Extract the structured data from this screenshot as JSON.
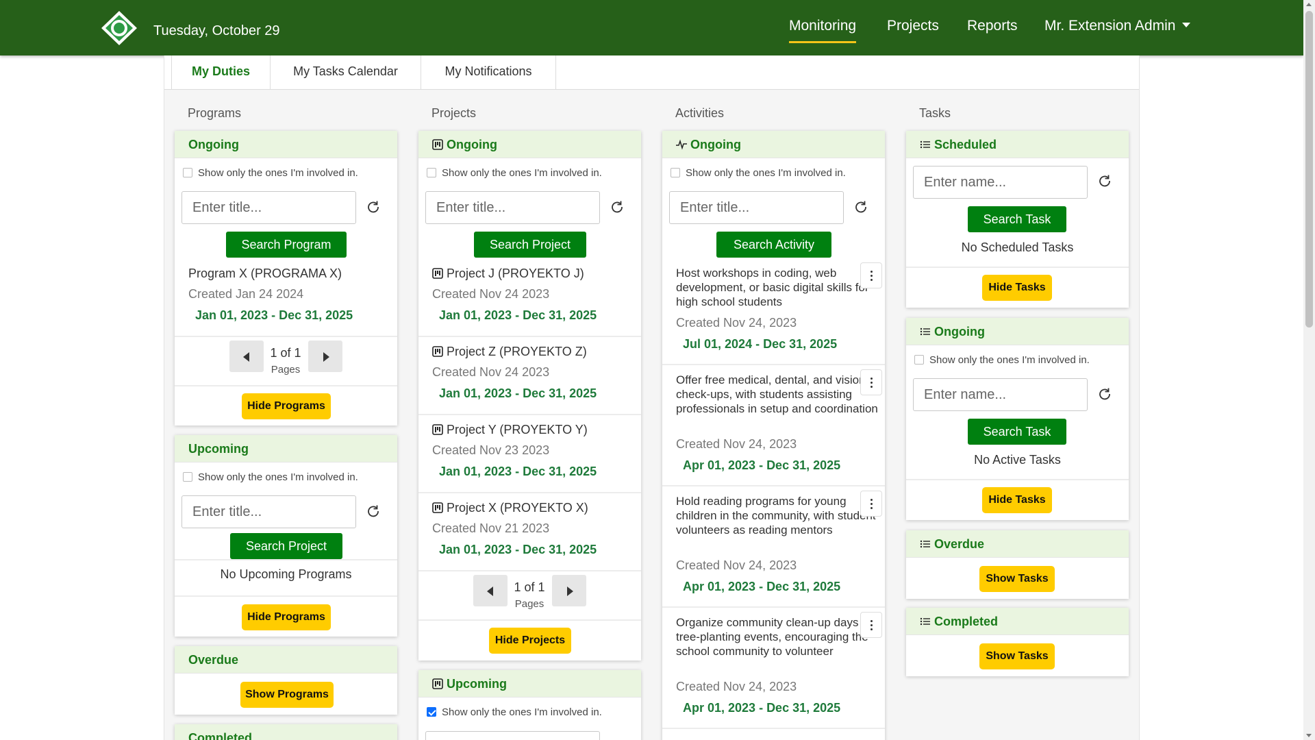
{
  "header": {
    "date": "Tuesday, October 29",
    "nav": {
      "monitoring": "Monitoring",
      "projects": "Projects",
      "reports": "Reports",
      "user": "Mr. Extension Admin"
    }
  },
  "tabs": {
    "duties": "My Duties",
    "calendar": "My Tasks Calendar",
    "notifications": "My Notifications"
  },
  "columns": {
    "programs": "Programs",
    "projects": "Projects",
    "activities": "Activities",
    "tasks": "Tasks"
  },
  "common": {
    "show_only": "Show only the ones I'm involved in."
  },
  "programs": {
    "ongoing": {
      "header": "Ongoing",
      "placeholder": "Enter title...",
      "search": "Search Program",
      "items": [
        {
          "title": "Program X (PROGRAMA X)",
          "created": "Created Jan 24 2024",
          "range": "Jan 01, 2023 - Dec 31, 2025"
        }
      ],
      "pager": {
        "count": "1 of 1",
        "label": "Pages"
      },
      "hide": "Hide Programs"
    },
    "upcoming": {
      "header": "Upcoming",
      "placeholder": "Enter title...",
      "search": "Search Project",
      "empty": "No Upcoming Programs",
      "hide": "Hide Programs"
    },
    "overdue": {
      "header": "Overdue",
      "show": "Show Programs"
    },
    "completed": {
      "header": "Completed"
    }
  },
  "projects": {
    "ongoing": {
      "header": "Ongoing",
      "placeholder": "Enter title...",
      "search": "Search Project",
      "items": [
        {
          "title": "Project J (PROYEKTO J)",
          "created": "Created Nov 24 2023",
          "range": "Jan 01, 2023 - Dec 31, 2025"
        },
        {
          "title": "Project Z (PROYEKTO Z)",
          "created": "Created Nov 24 2023",
          "range": "Jan 01, 2023 - Dec 31, 2025"
        },
        {
          "title": "Project Y (PROYEKTO Y)",
          "created": "Created Nov 23 2023",
          "range": "Jan 01, 2023 - Dec 31, 2025"
        },
        {
          "title": "Project X (PROYEKTO X)",
          "created": "Created Nov 21 2023",
          "range": "Jan 01, 2023 - Dec 31, 2025"
        }
      ],
      "pager": {
        "count": "1 of 1",
        "label": "Pages"
      },
      "hide": "Hide Projects"
    },
    "upcoming": {
      "header": "Upcoming",
      "show_only_checked": true
    }
  },
  "activities": {
    "ongoing": {
      "header": "Ongoing",
      "placeholder": "Enter title...",
      "search": "Search Activity",
      "items": [
        {
          "title": "Host workshops in coding, web development, or basic digital skills for high school students",
          "created": "Created Nov 24, 2023",
          "range": "Jul 01, 2024 - Dec 31, 2025"
        },
        {
          "title": "Offer free medical, dental, and vision check-ups, with students assisting professionals in setup and coordination",
          "created": "Created Nov 24, 2023",
          "range": "Apr 01, 2023 - Dec 31, 2025"
        },
        {
          "title": "Hold reading programs for young children in the community, with student volunteers as reading mentors",
          "created": "Created Nov 24, 2023",
          "range": "Apr 01, 2023 - Dec 31, 2025"
        },
        {
          "title": "Organize community clean-up days or tree-planting events, encouraging the school community to volunteer",
          "created": "Created Nov 24, 2023",
          "range": "Apr 01, 2023 - Dec 31, 2025"
        }
      ]
    }
  },
  "tasks": {
    "scheduled": {
      "header": "Scheduled",
      "placeholder": "Enter name...",
      "search": "Search Task",
      "empty": "No Scheduled Tasks",
      "hide": "Hide Tasks"
    },
    "ongoing": {
      "header": "Ongoing",
      "placeholder": "Enter name...",
      "search": "Search Task",
      "empty": "No Active Tasks",
      "hide": "Hide Tasks"
    },
    "overdue": {
      "header": "Overdue",
      "show": "Show Tasks"
    },
    "completed": {
      "header": "Completed",
      "show": "Show Tasks"
    }
  },
  "icons": [
    "app-logo-icon",
    "refresh-icon",
    "kanban-icon",
    "pulse-icon",
    "list-icon",
    "chevron-left-icon",
    "chevron-right-icon",
    "kebab-icon",
    "caret-down-icon"
  ],
  "colors": {
    "topbar": "#266019",
    "accent_green": "#008010",
    "header_green_bg": "#eaf5e0",
    "yellow": "#ffcc00",
    "range_green": "#1e7a3a"
  }
}
